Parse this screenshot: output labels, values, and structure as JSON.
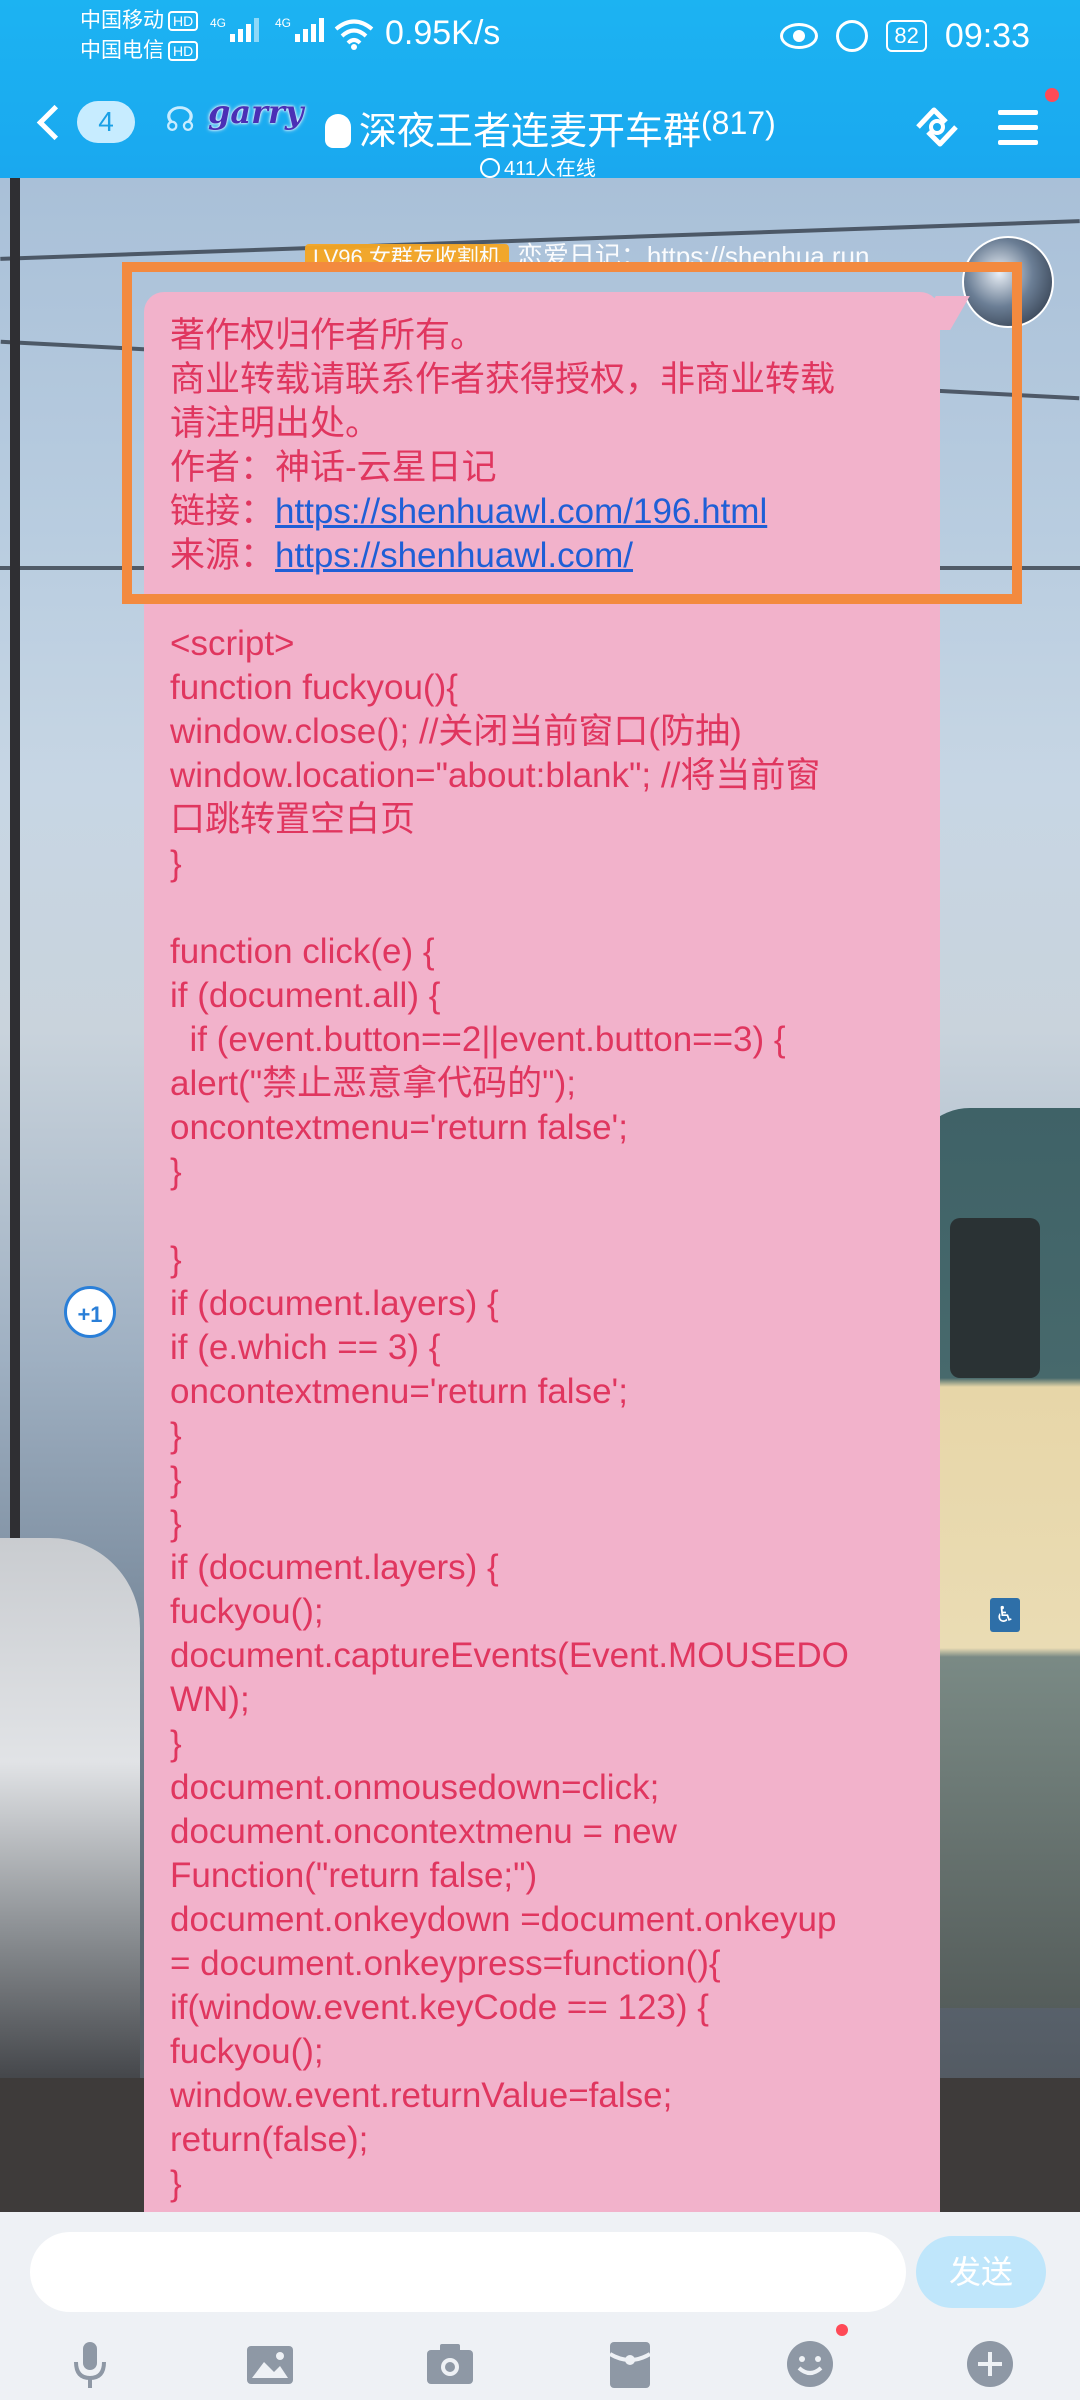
{
  "status": {
    "carrier1": "中国移动",
    "carrier2": "中国电信",
    "hd": "HD",
    "net": "4G",
    "speed": "0.95K/s",
    "battery": "82",
    "time": "09:33"
  },
  "header": {
    "back_count": "4",
    "logo_text": "garry",
    "title": "深夜王者连麦开车群",
    "member_count": "(817)",
    "online": "411人在线"
  },
  "chat": {
    "sender_title": "LV96 女群友收割机",
    "sender_name": "恋爱日记：https://shenhua.run",
    "plus_one": "+1",
    "lines": [
      {
        "t": "著作权归作者所有。"
      },
      {
        "t": "商业转载请联系作者获得授权，非商业转载"
      },
      {
        "t": "请注明出处。"
      },
      {
        "t": "作者：神话-云星日记"
      },
      {
        "t": "链接：",
        "link": "https://shenhuawl.com/196.html"
      },
      {
        "t": "来源：",
        "link": "https://shenhuawl.com/"
      },
      {
        "t": " "
      },
      {
        "t": "<script>"
      },
      {
        "t": "function fuckyou(){"
      },
      {
        "t": "window.close(); //关闭当前窗口(防抽)"
      },
      {
        "t": "window.location=\"about:blank\"; //将当前窗"
      },
      {
        "t": "口跳转置空白页"
      },
      {
        "t": "}"
      },
      {
        "t": " "
      },
      {
        "t": "function click(e) {"
      },
      {
        "t": "if (document.all) {"
      },
      {
        "t": "  if (event.button==2||event.button==3) {"
      },
      {
        "t": "alert(\"禁止恶意拿代码的\");"
      },
      {
        "t": "oncontextmenu='return false';"
      },
      {
        "t": "}"
      },
      {
        "t": " "
      },
      {
        "t": "}"
      },
      {
        "t": "if (document.layers) {"
      },
      {
        "t": "if (e.which == 3) {"
      },
      {
        "t": "oncontextmenu='return false';"
      },
      {
        "t": "}"
      },
      {
        "t": "}"
      },
      {
        "t": "}"
      },
      {
        "t": "if (document.layers) {"
      },
      {
        "t": "fuckyou();"
      },
      {
        "t": "document.captureEvents(Event.MOUSEDO"
      },
      {
        "t": "WN);"
      },
      {
        "t": "}"
      },
      {
        "t": "document.onmousedown=click;"
      },
      {
        "t": "document.oncontextmenu = new"
      },
      {
        "t": "Function(\"return false;\")"
      },
      {
        "t": "document.onkeydown =document.onkeyup"
      },
      {
        "t": "= document.onkeypress=function(){"
      },
      {
        "t": "if(window.event.keyCode == 123) {"
      },
      {
        "t": "fuckyou();"
      },
      {
        "t": "window.event.returnValue=false;"
      },
      {
        "t": "return(false);"
      },
      {
        "t": "}"
      },
      {
        "t": "}"
      }
    ]
  },
  "input": {
    "placeholder": "",
    "send_label": "发送"
  },
  "toolbar": {
    "icons": [
      "microphone-icon",
      "image-icon",
      "camera-icon",
      "red-packet-icon",
      "emoji-icon",
      "plus-icon"
    ]
  },
  "colors": {
    "header": "#1aa8ef",
    "bubble": "#f2b2cb",
    "message_text": "#e0365f",
    "link": "#1f5fd6",
    "highlight_box": "#f38a3f"
  }
}
